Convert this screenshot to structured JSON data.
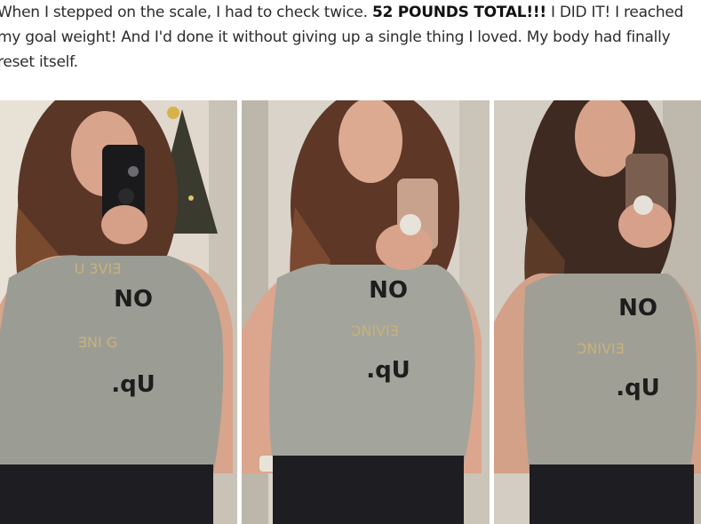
{
  "article": {
    "text_before": "When I stepped on the scale, I had to check twice. ",
    "highlight": "52 POUNDS TOTAL!!!",
    "text_after": " I DID IT! I reached my goal weight! And I'd done it without giving up a single thing I loved. My body had finally reset itself."
  },
  "photos": {
    "shirt_text_line1": "NO",
    "shirt_text_line2": ".qU",
    "colors": {
      "shirt": "#9b9c94",
      "hair": "#5a3626",
      "wall": "#d9d3c9",
      "skin": "#d9a48c",
      "shorts": "#1e1e22"
    }
  }
}
